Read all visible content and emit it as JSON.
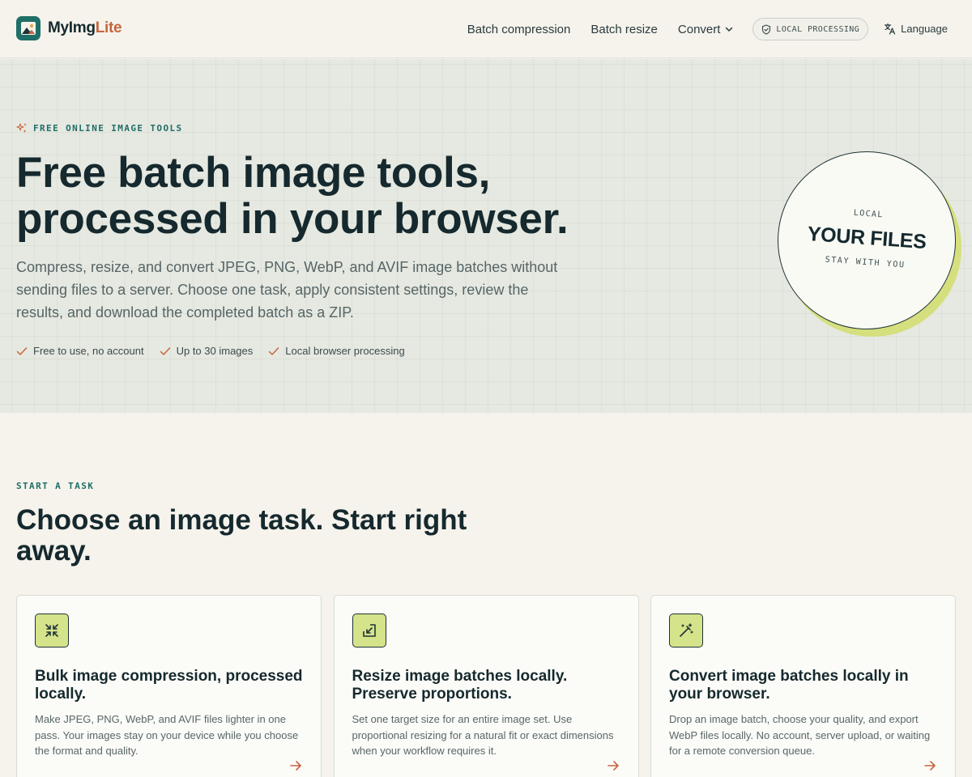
{
  "header": {
    "logo_part1": "MyImg",
    "logo_part2": "Lite",
    "nav": {
      "batch_compression": "Batch compression",
      "batch_resize": "Batch resize",
      "convert": "Convert"
    },
    "badge": "LOCAL PROCESSING",
    "language": "Language"
  },
  "hero": {
    "eyebrow": "FREE ONLINE IMAGE TOOLS",
    "title": "Free batch image tools, processed in your browser.",
    "subtitle": "Compress, resize, and convert JPEG, PNG, WebP, and AVIF image batches without sending files to a server. Choose one task, apply consistent settings, review the results, and download the completed batch as a ZIP.",
    "checks": [
      "Free to use, no account",
      "Up to 30 images",
      "Local browser processing"
    ],
    "stamp": {
      "top": "LOCAL",
      "main": "YOUR FILES",
      "bottom": "STAY WITH YOU"
    }
  },
  "tasks": {
    "eyebrow": "START A TASK",
    "title": "Choose an image task. Start right away.",
    "cards": [
      {
        "icon": "compress-icon",
        "title": "Bulk image compression, processed locally.",
        "description": "Make JPEG, PNG, WebP, and AVIF files lighter in one pass. Your images stay on your device while you choose the format and quality."
      },
      {
        "icon": "resize-icon",
        "title": "Resize image batches locally. Preserve proportions.",
        "description": "Set one target size for an entire image set. Use proportional resizing for a natural fit or exact dimensions when your workflow requires it."
      },
      {
        "icon": "magic-wand-icon",
        "title": "Convert image batches locally in your browser.",
        "description": "Drop an image batch, choose your quality, and export WebP files locally. No account, server upload, or waiting for a remote conversion queue."
      }
    ]
  },
  "colors": {
    "accent_teal": "#1f6e67",
    "accent_orange": "#c8653f",
    "accent_lime": "#d5e38a",
    "text_dark": "#15292e",
    "background": "#f5f3ec"
  }
}
